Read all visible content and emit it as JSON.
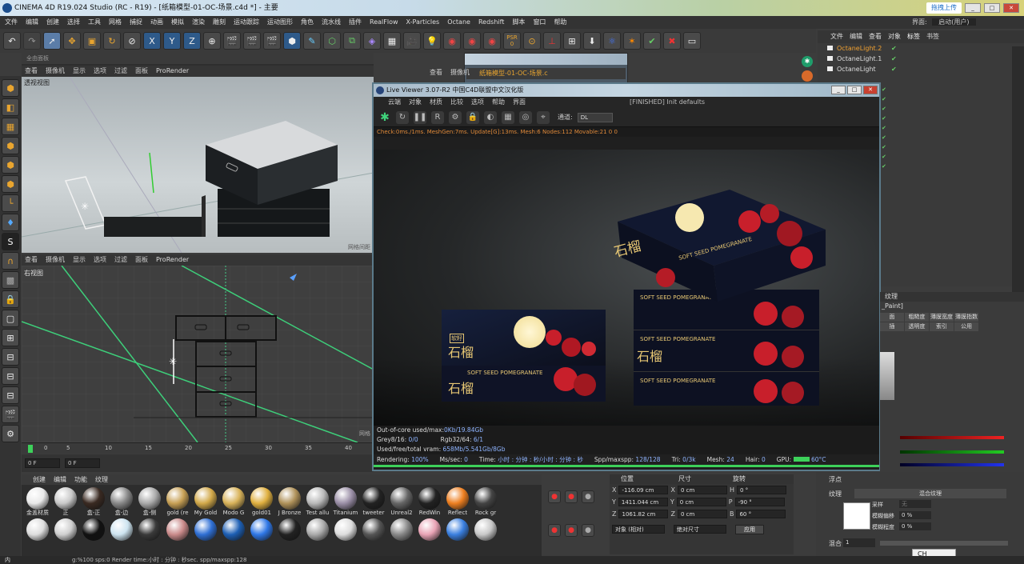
{
  "window": {
    "title": "CINEMA 4D R19.024 Studio (RC - R19) - [纸箱模型-01-OC-场景.c4d *] - 主要",
    "upload_label": "拖拽上传",
    "interface_label": "界面:",
    "interface_value": "启动(用户)"
  },
  "menu": [
    "文件",
    "编辑",
    "创建",
    "选择",
    "工具",
    "网格",
    "捕捉",
    "动画",
    "模拟",
    "渲染",
    "雕刻",
    "运动跟踪",
    "运动图形",
    "角色",
    "流水线",
    "插件",
    "RealFlow",
    "X-Particles",
    "Octane",
    "Redshift",
    "脚本",
    "窗口",
    "帮助"
  ],
  "toolbar": {
    "psr_label": "PSR",
    "psr_value": "0"
  },
  "viewport_top": {
    "tab": "全由面板",
    "menu": [
      "查看",
      "摄像机",
      "显示",
      "选项",
      "过滤",
      "面板",
      "ProRender"
    ],
    "label": "透视视图",
    "corner": "网格间距"
  },
  "viewport_bottom": {
    "menu": [
      "查看",
      "摄像机",
      "显示",
      "选项",
      "过滤",
      "面板",
      "ProRender"
    ],
    "label": "右视图",
    "corner": "网格"
  },
  "viewport_mid_menu": [
    "查看",
    "摄像机"
  ],
  "timeline": {
    "ticks": [
      "0",
      "5",
      "10",
      "15",
      "20",
      "25",
      "30",
      "35",
      "40"
    ],
    "frame_start": "0 F",
    "frame_field": "0 F"
  },
  "materials": {
    "tabs": [
      "创建",
      "编辑",
      "功能",
      "纹理"
    ],
    "row1": [
      {
        "name": "金盖材质",
        "color": "#e9e9e9"
      },
      {
        "name": "正",
        "color": "#c9c9c9"
      },
      {
        "name": "盒-正",
        "color": "#3a2a22"
      },
      {
        "name": "盒-边",
        "color": "#888888"
      },
      {
        "name": "盒-侧",
        "color": "#aaaaaa"
      },
      {
        "name": "gold (re",
        "color": "#c7a055"
      },
      {
        "name": "My Gold",
        "color": "#d2a94a"
      },
      {
        "name": "Modo G",
        "color": "#d9b35a"
      },
      {
        "name": "gold01",
        "color": "#e0b040"
      },
      {
        "name": "J Bronze",
        "color": "#b0925a"
      },
      {
        "name": "Test allu",
        "color": "#b9b9b9"
      },
      {
        "name": "Titanium",
        "color": "#9a8ea6"
      },
      {
        "name": "tweeter",
        "color": "#222222"
      },
      {
        "name": "Unreal2",
        "color": "#666666"
      }
    ],
    "row1b": [
      {
        "name": "RedWin",
        "color": "#222222"
      },
      {
        "name": "Reflect",
        "color": "#ee7f20"
      },
      {
        "name": "Rock gr",
        "color": "#444444"
      }
    ],
    "row2": [
      {
        "name": "",
        "color": "#ddd"
      },
      {
        "name": "",
        "color": "#cfcfcf"
      },
      {
        "name": "",
        "color": "#111"
      },
      {
        "name": "",
        "color": "#cde4f0"
      },
      {
        "name": "",
        "color": "#3a3a3a"
      },
      {
        "name": "",
        "color": "#c98a8a"
      },
      {
        "name": "",
        "color": "#2f6fd4"
      },
      {
        "name": "",
        "color": "#1d5fb4"
      },
      {
        "name": "",
        "color": "#2f77e6"
      },
      {
        "name": "",
        "color": "#222"
      },
      {
        "name": "",
        "color": "#aaa"
      },
      {
        "name": "",
        "color": "#ddd"
      },
      {
        "name": "",
        "color": "#555"
      },
      {
        "name": "",
        "color": "#888"
      }
    ],
    "row2b": [
      {
        "name": "",
        "color": "#e9a3b5"
      },
      {
        "name": "",
        "color": "#3a7fe0"
      },
      {
        "name": "",
        "color": "#c8c8c8"
      }
    ]
  },
  "status": {
    "left": "内",
    "text": "g:%100 sps:0 Render time:小时 : 分钟 : 秒sec. spp/maxspp:128"
  },
  "object_manager": {
    "tabs": [
      "文件",
      "编辑",
      "查看",
      "对象",
      "标签",
      "书签"
    ],
    "rows": [
      {
        "label": "OctaneLight.2",
        "selected": true
      },
      {
        "label": "OctaneLight.1",
        "selected": false
      },
      {
        "label": "OctaneLight",
        "selected": false
      }
    ]
  },
  "small_window": {
    "tab": "纸箱模型-01-OC-场景.c"
  },
  "live_viewer": {
    "title": "Live Viewer 3.07-R2 中国C4D联盟中文汉化版",
    "menu": [
      "云端",
      "对象",
      "材质",
      "比较",
      "选项",
      "帮助",
      "界面"
    ],
    "status": "[FINISHED] Init defaults",
    "channel_label": "通道:",
    "channel_value": "DL",
    "info": "Check:0ms./1ms. MeshGen:7ms. Update[G]:13ms. Mesh:6 Nodes:112 Movable:21  0 0",
    "stats1_label": "Out-of-core used/max:",
    "stats1_value": "0Kb/19.84Gb",
    "stats2_label": "Grey8/16:",
    "stats2_value": "0/0",
    "stats2b_label": "Rgb32/64:",
    "stats2b_value": "6/1",
    "stats3_label": "Used/free/total vram:",
    "stats3_value": "658Mb/5.541Gb/8Gb",
    "rendering_label": "Rendering:",
    "rendering_value": "100%",
    "ms_label": "Ms/sec:",
    "ms_value": "0",
    "time_label": "Time:",
    "time_value": "小时 : 分钟 : 秒/小时 : 分钟 : 秒",
    "spp_label": "Spp/maxspp:",
    "spp_value": "128/128",
    "tri_label": "Tri:",
    "tri_value": "0/3k",
    "mesh_label": "Mesh:",
    "mesh_value": "24",
    "hair_label": "Hair:",
    "hair_value": "0",
    "gpu_label": "GPU:",
    "gpu_temp": "60°C",
    "progress": 1.0,
    "product": {
      "brand_cn": "石榴",
      "tag_cn": "软籽",
      "brand_en": "SOFT SEED POMEGRANATE"
    }
  },
  "attributes": {
    "tab": "纹理",
    "paint": "_Paint]",
    "grid": [
      "面",
      "粗糙度",
      "薄膜宽度",
      "薄膜指数",
      "插",
      "透明度",
      "索引",
      "公用"
    ],
    "texture_label": "纹理",
    "mix_label": "混合纹理",
    "sample_label": "采样",
    "sample_value": "无",
    "blur_offset_label": "模糊偏移",
    "blur_offset_value": "0 %",
    "blur_scale_label": "模糊程度",
    "blur_scale_value": "0 %",
    "float_label": "浮点",
    "blend_label": "混合",
    "blend_value": "1"
  },
  "coords": {
    "headers": [
      "位置",
      "尺寸",
      "旋转"
    ],
    "rows": [
      {
        "axis": "X",
        "pos": "-116.09 cm",
        "size": "0 cm",
        "rot_axis": "H",
        "rot": "0 °"
      },
      {
        "axis": "Y",
        "pos": "1411.044 cm",
        "size": "0 cm",
        "rot_axis": "P",
        "rot": "-90 °"
      },
      {
        "axis": "Z",
        "pos": "1061.82 cm",
        "size": "0 cm",
        "rot_axis": "B",
        "rot": "60 °"
      }
    ],
    "mode": "对象 (相对)",
    "size_mode": "绝对尺寸",
    "apply": "应用"
  },
  "ime": "CH"
}
